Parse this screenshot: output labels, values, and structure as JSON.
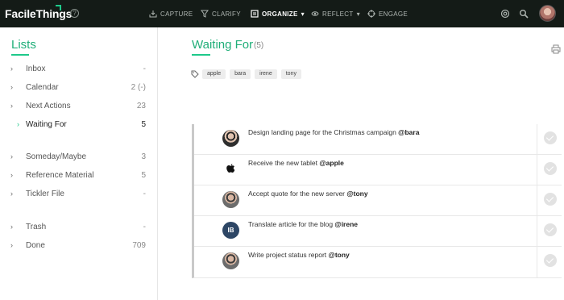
{
  "app": {
    "logo": "FacileThings",
    "help": "?"
  },
  "nav": [
    {
      "label": "CAPTURE",
      "icon": "tray-in-icon"
    },
    {
      "label": "CLARIFY",
      "icon": "filter-icon"
    },
    {
      "label": "ORGANIZE",
      "icon": "organize-icon",
      "active": true,
      "chevron": "▾"
    },
    {
      "label": "REFLECT",
      "icon": "reflect-icon",
      "chevron": "▾"
    },
    {
      "label": "ENGAGE",
      "icon": "target-icon"
    }
  ],
  "sidebar": {
    "title": "Lists",
    "items": [
      {
        "label": "Inbox",
        "count": "-"
      },
      {
        "label": "Calendar",
        "count": "2 (-)"
      },
      {
        "label": "Next Actions",
        "count": "23"
      },
      {
        "label": "Waiting For",
        "count": "5",
        "active": true
      },
      {
        "label": "Someday/Maybe",
        "count": "3"
      },
      {
        "label": "Reference Material",
        "count": "5"
      },
      {
        "label": "Tickler File",
        "count": "-"
      },
      {
        "label": "Trash",
        "count": "-"
      },
      {
        "label": "Done",
        "count": "709"
      }
    ],
    "chevron": "›"
  },
  "main": {
    "title": "Waiting For",
    "count": "(5)",
    "tags": [
      "apple",
      "bara",
      "irene",
      "tony"
    ],
    "tasks": [
      {
        "text": "Design landing page for the Christmas campaign ",
        "mention": "@bara",
        "avatar": "photo-dark"
      },
      {
        "text": "Receive the new tablet ",
        "mention": "@apple",
        "avatar": "apple"
      },
      {
        "text": "Accept quote for the new server ",
        "mention": "@tony",
        "avatar": "photo"
      },
      {
        "text": "Translate article for the blog ",
        "mention": "@irene",
        "avatar": "initials",
        "initials": "IB"
      },
      {
        "text": "Write project status report ",
        "mention": "@tony",
        "avatar": "photo"
      }
    ]
  },
  "colors": {
    "accent": "#1ec98a",
    "topbar": "#141b17",
    "initials_bg": "#2d4665"
  }
}
